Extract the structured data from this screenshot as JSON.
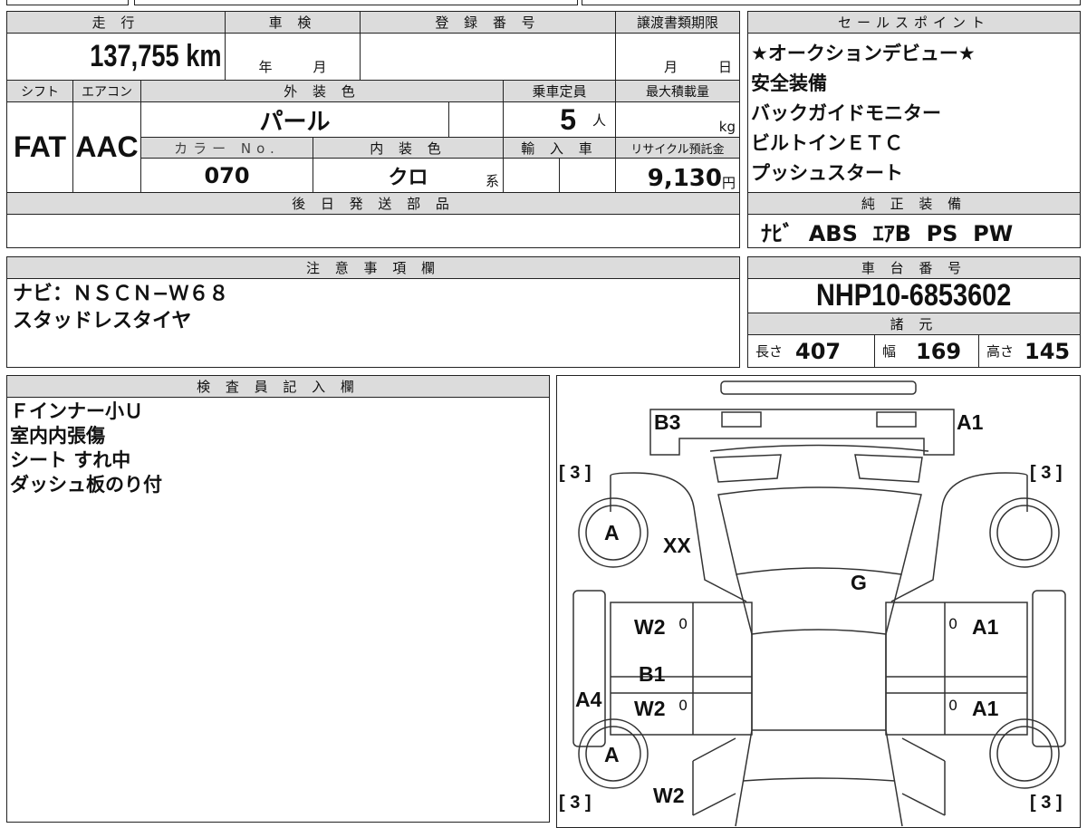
{
  "info": {
    "mileage_label": "走 行",
    "mileage": "137,755",
    "mileage_unit": "km",
    "inspection_label": "車 検",
    "inspection_year": "年",
    "inspection_month": "月",
    "registration_label": "登 録 番 号",
    "transfer_label": "譲渡書類期限",
    "transfer_month": "月",
    "transfer_day": "日",
    "shift_label": "シフト",
    "shift": "FAT",
    "ac_label": "エアコン",
    "ac": "AAC",
    "exterior_label": "外 装 色",
    "exterior": "パール",
    "capacity_label": "乗車定員",
    "capacity": "5",
    "capacity_unit": "人",
    "maxload_label": "最大積載量",
    "maxload_unit": "kg",
    "colorno_label": "カラー No.",
    "colorno": "070",
    "interior_label": "内 装 色",
    "interior": "クロ",
    "interior_suffix": "系",
    "import_label": "輸 入 車",
    "recycle_label": "リサイクル預託金",
    "recycle": "9,130",
    "recycle_unit": "円",
    "later_parts_label": "後 日 発 送 部 品"
  },
  "sales": {
    "label": "セールスポイント",
    "items": [
      "★オークションデビュー★",
      "安全装備",
      "バックガイドモニター",
      "ビルトインＥＴＣ",
      "プッシュスタート"
    ]
  },
  "equipment": {
    "label": "純 正 装 備",
    "value": "ﾅﾋﾞ  ABS  ｴｱB  PS  PW"
  },
  "notes": {
    "label": "注 意 事 項 欄",
    "items": [
      "ナビ：ＮＳＣＮ−Ｗ６８",
      "スタッドレスタイヤ"
    ]
  },
  "chassis": {
    "label": "車 台 番 号",
    "value": "NHP10-6853602",
    "specs_label": "諸 元",
    "length_label": "長さ",
    "length": "407",
    "width_label": "幅",
    "width": "169",
    "height_label": "高さ",
    "height": "145"
  },
  "inspector": {
    "label": "検 査 員 記 入 欄",
    "items": [
      "Ｆインナー小Ｕ",
      "室内内張傷",
      "シート すれ中",
      "ダッシュ板のり付"
    ]
  },
  "diagram": {
    "marks": {
      "front_left": "B3",
      "front_right": "A1",
      "tire_fl": "A",
      "tire_rl": "A",
      "fender_l": "XX",
      "windshield": "G",
      "door_fl": "W2",
      "door_rl_top": "B1",
      "door_rl": "W2",
      "sill_l": "A4",
      "quarter_l": "W2",
      "door_fr": "A1",
      "door_rr": "A1",
      "tread_fl": "3",
      "tread_fr": "3",
      "tread_rl": "3",
      "tread_rr": "3",
      "zero": "0"
    }
  }
}
